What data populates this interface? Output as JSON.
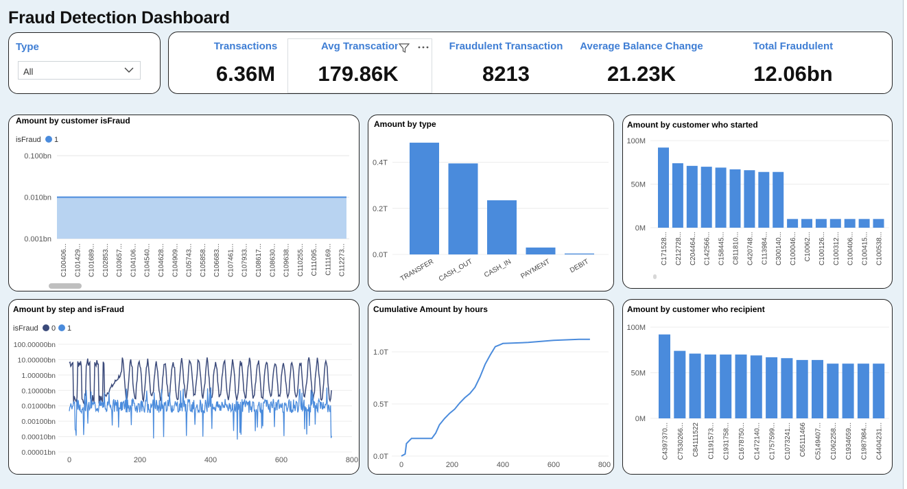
{
  "header": {
    "title": "Fraud Detection Dashboard"
  },
  "slicer": {
    "label": "Type",
    "selected": "All"
  },
  "kpis": [
    {
      "label": "Transactions",
      "value": "6.36M"
    },
    {
      "label": "Avg Transcation",
      "value": "179.86K"
    },
    {
      "label": "Fraudulent Transaction",
      "value": "8213"
    },
    {
      "label": "Average Balance Change",
      "value": "21.23K"
    },
    {
      "label": "Total Fraudulent",
      "value": "12.06bn"
    }
  ],
  "colors": {
    "accent": "#3f7ed4",
    "bar": "#4a8bdc",
    "area": "#b8d3f1",
    "line_dark": "#3b4a7a",
    "line_light": "#4a8bdc"
  },
  "chart_data": [
    {
      "id": "c1",
      "type": "area",
      "title": "Amount by customer  isFraud",
      "legend": {
        "title": "isFraud",
        "items": [
          {
            "name": "1",
            "color": "#4a8bdc"
          }
        ]
      },
      "y_ticks": [
        "0.100bn",
        "0.010bn",
        "0.001bn"
      ],
      "scale": "log",
      "categories": [
        "C100406...",
        "C101429...",
        "C101689...",
        "C102853...",
        "C103657...",
        "C104106...",
        "C104540...",
        "C104628...",
        "C104909...",
        "C105743...",
        "C105858...",
        "C106683...",
        "C107461...",
        "C107933...",
        "C108617...",
        "C108630...",
        "C109638...",
        "C110255...",
        "C111095...",
        "C111169...",
        "C112273..."
      ],
      "values_bn": [
        0.01,
        0.01,
        0.01,
        0.01,
        0.01,
        0.01,
        0.01,
        0.01,
        0.01,
        0.01,
        0.01,
        0.01,
        0.01,
        0.01,
        0.01,
        0.01,
        0.01,
        0.01,
        0.01,
        0.01,
        0.01
      ]
    },
    {
      "id": "c2",
      "type": "bar",
      "title": "Amount by type",
      "y_ticks": [
        "0.4T",
        "0.2T",
        "0.0T"
      ],
      "ylim": [
        0,
        0.5
      ],
      "categories": [
        "TRANSFER",
        "CASH_OUT",
        "CASH_IN",
        "PAYMENT",
        "DEBIT"
      ],
      "values": [
        0.485,
        0.395,
        0.235,
        0.03,
        0.004
      ]
    },
    {
      "id": "c3",
      "type": "bar",
      "title": "Amount by customer who started",
      "y_ticks": [
        "100M",
        "50M",
        "0M"
      ],
      "ylim": [
        0,
        100
      ],
      "categories": [
        "C171528...",
        "C212728...",
        "C204464...",
        "C142566...",
        "C158445...",
        "C811810...",
        "C420748...",
        "C113984...",
        "C300140...",
        "C100046...",
        "C10062...",
        "C100126...",
        "C100312...",
        "C100406...",
        "C100415...",
        "C100538..."
      ],
      "values": [
        92,
        74,
        71,
        70,
        69,
        67,
        66,
        64,
        64,
        10,
        10,
        10,
        10,
        10,
        10,
        10
      ]
    },
    {
      "id": "c4",
      "type": "line",
      "title": "Amount by step and isFraud",
      "legend": {
        "title": "isFraud",
        "items": [
          {
            "name": "0",
            "color": "#3b4a7a"
          },
          {
            "name": "1",
            "color": "#4a8bdc"
          }
        ]
      },
      "y_ticks": [
        "100.00000bn",
        "10.00000bn",
        "1.00000bn",
        "0.10000bn",
        "0.01000bn",
        "0.00100bn",
        "0.00010bn",
        "0.00001bn"
      ],
      "x_ticks": [
        "0",
        "200",
        "400",
        "600",
        "800"
      ],
      "scale": "log",
      "xlim": [
        0,
        800
      ]
    },
    {
      "id": "c5",
      "type": "line",
      "title": "Cumulative Amount by hours",
      "y_ticks": [
        "1.0T",
        "0.5T",
        "0.0T"
      ],
      "x_ticks": [
        "0",
        "200",
        "400",
        "600",
        "800"
      ],
      "xlim": [
        0,
        800
      ],
      "ylim": [
        0,
        1.25
      ],
      "x": [
        0,
        15,
        20,
        40,
        120,
        135,
        150,
        170,
        190,
        210,
        230,
        250,
        270,
        290,
        310,
        330,
        350,
        370,
        390,
        400,
        500,
        600,
        700,
        743
      ],
      "y": [
        0,
        0.02,
        0.12,
        0.17,
        0.17,
        0.22,
        0.3,
        0.36,
        0.41,
        0.45,
        0.51,
        0.56,
        0.6,
        0.66,
        0.76,
        0.88,
        0.97,
        1.05,
        1.07,
        1.08,
        1.09,
        1.11,
        1.12,
        1.12
      ]
    },
    {
      "id": "c6",
      "type": "bar",
      "title": "Amount by customer who recipient",
      "y_ticks": [
        "100M",
        "50M",
        "0M"
      ],
      "ylim": [
        0,
        100
      ],
      "categories": [
        "C4397370...",
        "C7530266...",
        "C84111522",
        "C1191573...",
        "C1931758...",
        "C1678750...",
        "C1472140...",
        "C1757599...",
        "C1073241...",
        "C65111466",
        "C5149407...",
        "C1062258...",
        "C1934659...",
        "C1987984...",
        "C4404231..."
      ],
      "values": [
        92,
        74,
        71,
        70,
        70,
        70,
        69,
        67,
        66,
        64,
        64,
        60,
        60,
        60,
        60
      ]
    }
  ]
}
